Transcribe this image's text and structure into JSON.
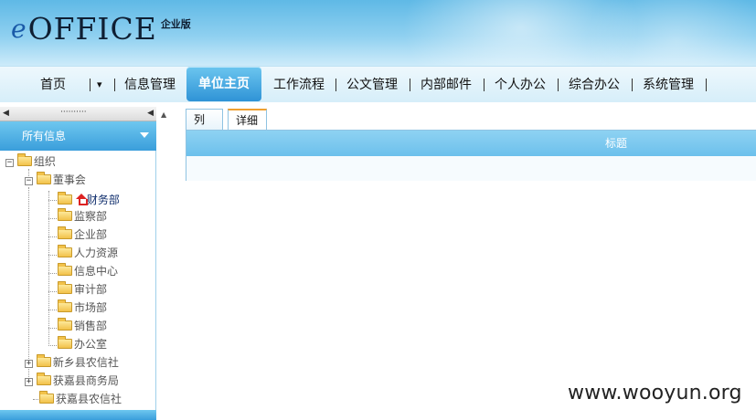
{
  "header": {
    "logo_prefix": "e",
    "logo_text": "OFFICE",
    "edition": "企业版"
  },
  "nav": {
    "items": [
      {
        "label": "首页"
      },
      {
        "label": "▾"
      },
      {
        "label": "信息管理"
      },
      {
        "label": "单位主页",
        "active": true
      },
      {
        "label": "工作流程"
      },
      {
        "label": "公文管理"
      },
      {
        "label": "内部邮件"
      },
      {
        "label": "个人办公"
      },
      {
        "label": "综合办公"
      },
      {
        "label": "系统管理"
      }
    ]
  },
  "left_panel": {
    "title": "所有信息",
    "tree": [
      {
        "label": "组织",
        "expander": "−"
      },
      {
        "label": "董事会",
        "expander": "−"
      },
      {
        "label": "财务部",
        "selected": true
      },
      {
        "label": "监察部"
      },
      {
        "label": "企业部"
      },
      {
        "label": "人力资源"
      },
      {
        "label": "信息中心"
      },
      {
        "label": "审计部"
      },
      {
        "label": "市场部"
      },
      {
        "label": "销售部"
      },
      {
        "label": "办公室"
      },
      {
        "label": "新乡县农信社",
        "expander": "+"
      },
      {
        "label": "获嘉县商务局",
        "expander": "+"
      },
      {
        "label": "获嘉县农信社"
      }
    ]
  },
  "tabs": [
    {
      "label": "列表"
    },
    {
      "label": "详细",
      "active": true
    }
  ],
  "grid": {
    "columns": [
      "标题"
    ]
  },
  "watermark": "www.wooyun.org",
  "colors": {
    "accent": "#3a9edb",
    "nav_active": "#2f93d6",
    "tab_active_border": "#f0a030"
  }
}
